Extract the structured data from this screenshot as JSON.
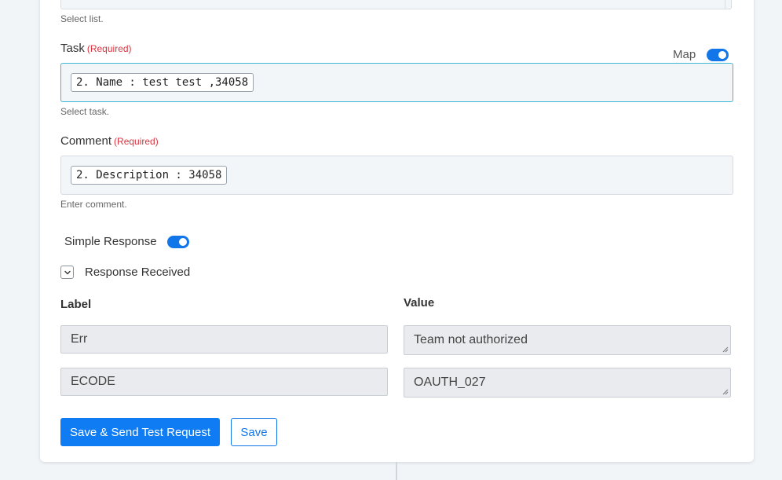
{
  "list_field": {
    "hint": "Select list."
  },
  "task_field": {
    "label": "Task",
    "required": "(Required)",
    "map_label": "Map",
    "value_pill": "2. Name : test test ,34058",
    "hint": "Select task."
  },
  "comment_field": {
    "label": "Comment",
    "required": "(Required)",
    "value_pill": "2. Description : 34058",
    "hint": "Enter comment."
  },
  "simple_response": {
    "label": "Simple Response",
    "enabled": true
  },
  "response_received": {
    "label": "Response Received",
    "expanded": false
  },
  "response_table": {
    "label_header": "Label",
    "value_header": "Value",
    "rows": [
      {
        "label": "Err",
        "value": "Team not authorized"
      },
      {
        "label": "ECODE",
        "value": "OAUTH_027"
      }
    ]
  },
  "actions": {
    "save_send": "Save & Send Test Request",
    "save": "Save"
  },
  "colors": {
    "accent": "#0f7cf3",
    "required": "#d9333f",
    "focus_border": "#3fb6d6"
  }
}
